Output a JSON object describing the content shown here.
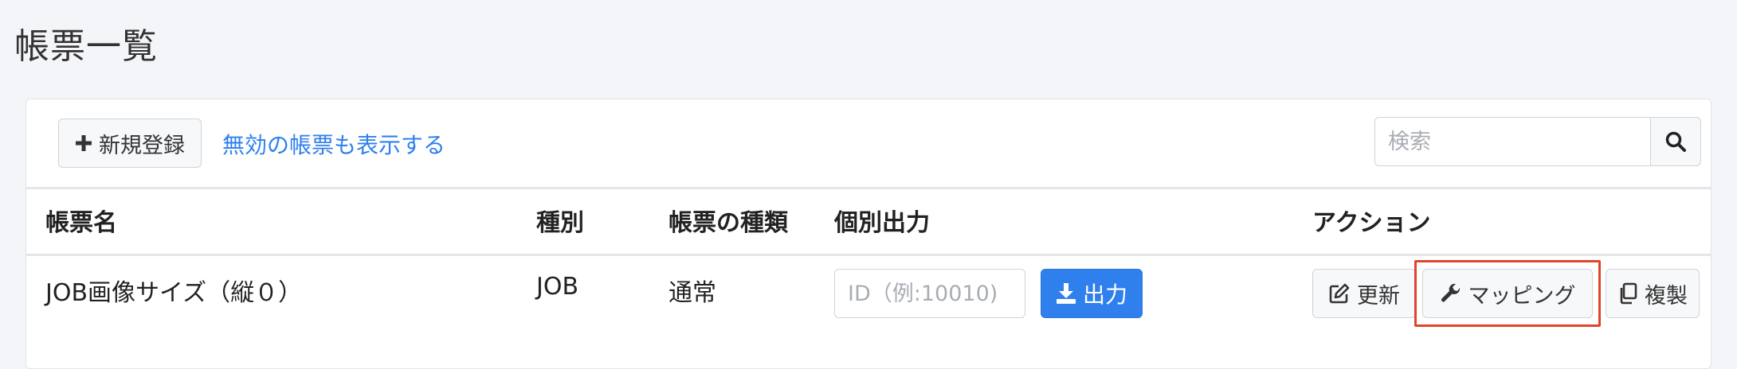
{
  "page": {
    "title": "帳票一覧"
  },
  "toolbar": {
    "new_label": "新規登録",
    "show_invalid_label": "無効の帳票も表示する",
    "search_placeholder": "検索"
  },
  "table": {
    "headers": [
      "帳票名",
      "種別",
      "帳票の種類",
      "個別出力",
      "アクション"
    ],
    "rows": [
      {
        "name": "JOB画像サイズ（縦０）",
        "type": "JOB",
        "kind": "通常",
        "id_placeholder": "ID（例:10010)",
        "output_label": "出力",
        "actions": {
          "update": "更新",
          "mapping": "マッピング",
          "copy": "複製"
        }
      }
    ]
  },
  "colors": {
    "accent": "#2f80ed",
    "highlight": "#e0442c"
  },
  "icons": [
    "plus-icon",
    "search-icon",
    "download-icon",
    "edit-icon",
    "wrench-icon",
    "copy-icon"
  ]
}
